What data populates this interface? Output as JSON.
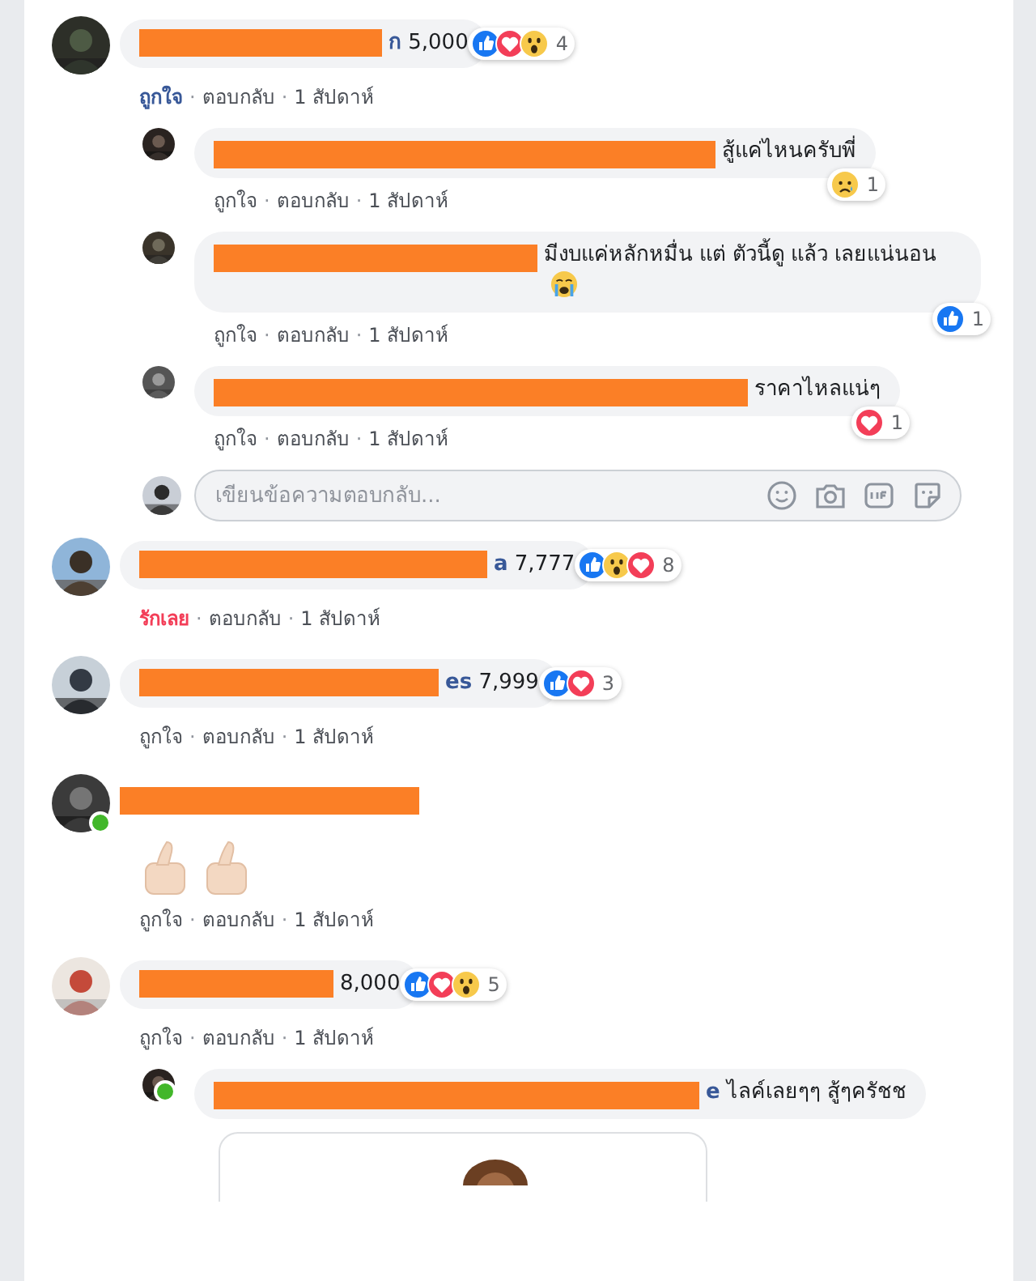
{
  "comments": [
    {
      "kind": "text",
      "text": "**ก** 5,000",
      "reactions": [
        {
          "kind": "like"
        },
        {
          "kind": "love"
        },
        {
          "kind": "wow"
        }
      ],
      "reaction_count": "4",
      "my_reaction": {
        "kind": "like"
      },
      "online": false,
      "actions": [
        {
          "kind": "like",
          "label": "ถูกใจ"
        },
        {
          "kind": "sep",
          "label": "·"
        },
        {
          "kind": "reply",
          "label": "ตอบกลับ"
        },
        {
          "kind": "sep",
          "label": "·"
        },
        {
          "kind": "time",
          "label": "1 สัปดาห์"
        }
      ],
      "replies": [
        {
          "text": "สู้แค่ไหนครับพี่",
          "trailing_emoji": false,
          "reactions": [
            {
              "kind": "sad"
            }
          ],
          "reaction_count": "1",
          "online": false,
          "actions": [
            {
              "kind": "like",
              "label": "ถูกใจ"
            },
            {
              "kind": "sep",
              "label": "·"
            },
            {
              "kind": "reply",
              "label": "ตอบกลับ"
            },
            {
              "kind": "sep",
              "label": "·"
            },
            {
              "kind": "time",
              "label": "1 สัปดาห์"
            }
          ]
        },
        {
          "text": "มีงบแค่หลักหมื่น แต่ ตัวนี้ดู แล้ว เลยแน่นอน",
          "trailing_emoji": true,
          "reactions": [
            {
              "kind": "like"
            }
          ],
          "reaction_count": "1",
          "online": false,
          "actions": [
            {
              "kind": "like",
              "label": "ถูกใจ"
            },
            {
              "kind": "sep",
              "label": "·"
            },
            {
              "kind": "reply",
              "label": "ตอบกลับ"
            },
            {
              "kind": "sep",
              "label": "·"
            },
            {
              "kind": "time",
              "label": "1 สัปดาห์"
            }
          ]
        },
        {
          "text": "ราคาไหลแน่ๆ",
          "trailing_emoji": false,
          "reactions": [
            {
              "kind": "love"
            }
          ],
          "reaction_count": "1",
          "online": false,
          "actions": [
            {
              "kind": "like",
              "label": "ถูกใจ"
            },
            {
              "kind": "sep",
              "label": "·"
            },
            {
              "kind": "reply",
              "label": "ตอบกลับ"
            },
            {
              "kind": "sep",
              "label": "·"
            },
            {
              "kind": "time",
              "label": "1 สัปดาห์"
            }
          ]
        }
      ],
      "reply_box": {
        "placeholder": "เขียนข้อความตอบกลับ..."
      }
    },
    {
      "kind": "text",
      "text": "**a** 7,777",
      "reactions": [
        {
          "kind": "like"
        },
        {
          "kind": "wow"
        },
        {
          "kind": "love"
        }
      ],
      "reaction_count": "8",
      "my_reaction": {
        "kind": "love"
      },
      "online": false,
      "actions": [
        {
          "kind": "like",
          "label": "รักเลย"
        },
        {
          "kind": "sep",
          "label": "·"
        },
        {
          "kind": "reply",
          "label": "ตอบกลับ"
        },
        {
          "kind": "sep",
          "label": "·"
        },
        {
          "kind": "time",
          "label": "1 สัปดาห์"
        }
      ]
    },
    {
      "kind": "text",
      "text": "**es** 7,999",
      "reactions": [
        {
          "kind": "like"
        },
        {
          "kind": "love"
        }
      ],
      "reaction_count": "3",
      "online": false,
      "actions": [
        {
          "kind": "like",
          "label": "ถูกใจ"
        },
        {
          "kind": "sep",
          "label": "·"
        },
        {
          "kind": "reply",
          "label": "ตอบกลับ"
        },
        {
          "kind": "sep",
          "label": "·"
        },
        {
          "kind": "time",
          "label": "1 สัปดาห์"
        }
      ]
    },
    {
      "kind": "emoji",
      "online": true,
      "actions": [
        {
          "kind": "like",
          "label": "ถูกใจ"
        },
        {
          "kind": "sep",
          "label": "·"
        },
        {
          "kind": "reply",
          "label": "ตอบกลับ"
        },
        {
          "kind": "sep",
          "label": "·"
        },
        {
          "kind": "time",
          "label": "1 สัปดาห์"
        }
      ]
    },
    {
      "kind": "text",
      "text": "8,000",
      "reactions": [
        {
          "kind": "like"
        },
        {
          "kind": "love"
        },
        {
          "kind": "wow"
        }
      ],
      "reaction_count": "5",
      "online": false,
      "actions": [
        {
          "kind": "like",
          "label": "ถูกใจ"
        },
        {
          "kind": "sep",
          "label": "·"
        },
        {
          "kind": "reply",
          "label": "ตอบกลับ"
        },
        {
          "kind": "sep",
          "label": "·"
        },
        {
          "kind": "time",
          "label": "1 สัปดาห์"
        }
      ],
      "replies": [
        {
          "text": "**e** ไลค์เลยๆๆ สู้ๆครัชช",
          "trailing_emoji": false,
          "online": true
        }
      ],
      "preview_card": true
    }
  ]
}
